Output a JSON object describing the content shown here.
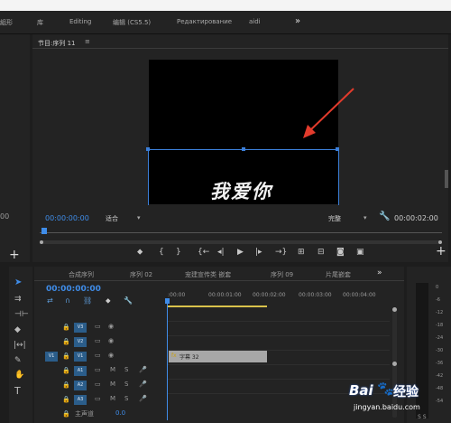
{
  "menubar": {
    "left_fragment": "組形",
    "tabs": [
      "库",
      "Editing",
      "编辑 (CS5.5)",
      "Редактирование",
      "aidi"
    ],
    "more": "»"
  },
  "left_panel": {
    "timecode_fragment": "00",
    "add": "+"
  },
  "program_monitor": {
    "title": "节目:序列 11",
    "menu_icon": "≡",
    "subtitle": "我爱你",
    "timecode_left": "00:00:00:00",
    "fit_label": "适合",
    "quality_label": "完整",
    "timecode_right": "00:00:02:00",
    "add": "+"
  },
  "timeline": {
    "tabs": [
      "合成序列",
      "序列 02",
      "宠建宣传类 嵌套",
      "序列 09",
      "片尾嵌套"
    ],
    "more": "»",
    "timecode": "00:00:00:00",
    "ruler": [
      ":00:00",
      "00:00:01:00",
      "00:00:02:00",
      "00:00:03:00",
      "00:00:04:00"
    ],
    "clip_label": "字幕 32",
    "video_tracks": [
      "V3",
      "V2",
      "V1"
    ],
    "v1_source": "V1",
    "audio_tracks": [
      "A1",
      "A2",
      "A3"
    ],
    "audio_toggles": [
      "M",
      "S"
    ],
    "master_label": "主声道",
    "master_value": "0.0"
  },
  "meters": {
    "scale": [
      "0",
      "-6",
      "-12",
      "-18",
      "-24",
      "-30",
      "-36",
      "-42",
      "-48",
      "-54"
    ],
    "bottom": "S S"
  },
  "watermark": {
    "brand": "Bai",
    "brand2": "经验",
    "url": "jingyan.baidu.com"
  },
  "colors": {
    "accent": "#3f8ce8",
    "arrow": "#e23b2c",
    "clip": "#a7a7a7"
  }
}
